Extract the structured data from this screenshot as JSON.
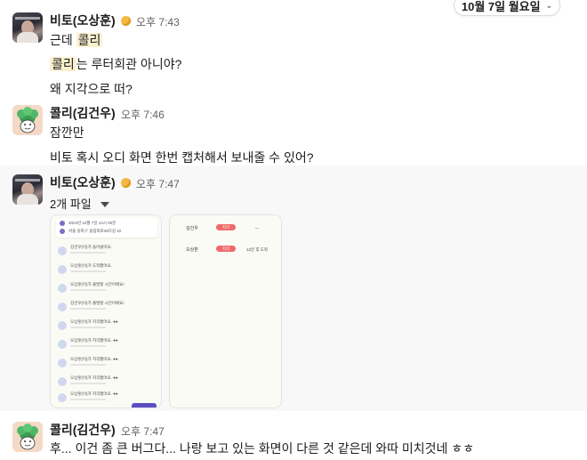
{
  "date_divider": {
    "label": "10월 7일 월요일"
  },
  "messages": [
    {
      "author": "비토(오상훈)",
      "time": "오후 7:43",
      "lines": [
        "근데 ",
        "콜리",
        "콜리",
        "는 루터회관 아니야?",
        "왜 지각으로 떠?"
      ]
    },
    {
      "author": "콜리(김건우)",
      "time": "오후 7:46",
      "lines": [
        "잠깐만",
        "비토 혹시 오디 화면 한번 캡처해서 보내줄 수 있어?"
      ]
    },
    {
      "author": "비토(오상훈)",
      "time": "오후 7:47",
      "files_label": "2개 파일"
    },
    {
      "author": "콜리(김건우)",
      "time": "오후 7:47",
      "lines": [
        "후... 이건 좀 큰 버그다... 나랑 보고 있는 화면이 다른 것 같은데 와따 미치것네 ㅎㅎ"
      ]
    }
  ],
  "screenshot1": {
    "header_line1": "2024년 10월 7일 13시 00분",
    "header_line2": "서울 송파구 올림픽로35다길 42",
    "items": [
      "김건우(이)가 들어왔어요.",
      "오상훈(이)가 도착했어요.",
      "오상훈(이)가 출발할 시간이에요!",
      "김건우(이)가 출발할 시간이에요!",
      "오상훈(이)가 지각했어요. ●●",
      "오상훈(이)가 지각했어요. ●●",
      "오상훈(이)가 지각했어요. ●●",
      "오상훈(이)가 지각했어요. ●●",
      "오상훈(이)가 지각했어요. ●●"
    ]
  },
  "screenshot2": {
    "row1_name": "김건우",
    "row1_badge": "지각",
    "row2_name": "오상훈",
    "row2_badge": "지각",
    "row2_status": "12분 후 도착"
  },
  "colors": {
    "mention_highlight": "#fbf1cf",
    "hover_background": "#f8f8f8",
    "badge": "#f06a6a",
    "button": "#5b4ec4"
  }
}
